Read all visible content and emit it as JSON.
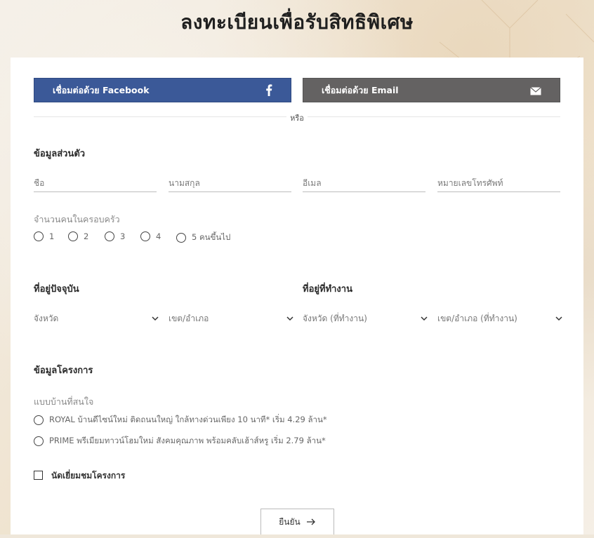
{
  "header": {
    "title": "ลงทะเบียนเพื่อรับสิทธิพิเศษ"
  },
  "social": {
    "facebook_label": "เชื่อมต่อด้วย Facebook",
    "email_label": "เชื่อมต่อด้วย Email",
    "divider_text": "หรือ"
  },
  "personal": {
    "heading": "ข้อมูลส่วนตัว",
    "first_name_placeholder": "ชื่อ",
    "last_name_placeholder": "นามสกุล",
    "email_placeholder": "อีเมล",
    "phone_placeholder": "หมายเลขโทรศัพท์",
    "family_label": "จำนวนคนในครอบครัว",
    "family_options": [
      "1",
      "2",
      "3",
      "4",
      "5 คนขึ้นไป"
    ]
  },
  "address": {
    "current_heading": "ที่อยู่ปัจจุบัน",
    "work_heading": "ที่อยู่ที่ทำงาน",
    "province": "จังหวัด",
    "district": "เขต/อำเภอ",
    "work_province": "จังหวัด (ที่ทำงาน)",
    "work_district": "เขต/อำเภอ (ที่ทำงาน)"
  },
  "project": {
    "heading": "ข้อมูลโครงการ",
    "interest_label": "แบบบ้านที่สนใจ",
    "options": [
      "ROYAL บ้านดีไซน์ใหม่ ติดถนนใหญ่ ใกล้ทางด่วนเพียง 10 นาที* เริ่ม 4.29 ล้าน*",
      "PRIME พรีเมียมทาวน์โฮมใหม่ สังคมคุณภาพ พร้อมคลับเฮ้าส์หรู เริ่ม 2.79 ล้าน*"
    ],
    "visit_label": "นัดเยี่ยมชมโครงการ"
  },
  "submit_label": "ยืนยัน",
  "colors": {
    "facebook": "#3b5998",
    "email": "#646262"
  }
}
